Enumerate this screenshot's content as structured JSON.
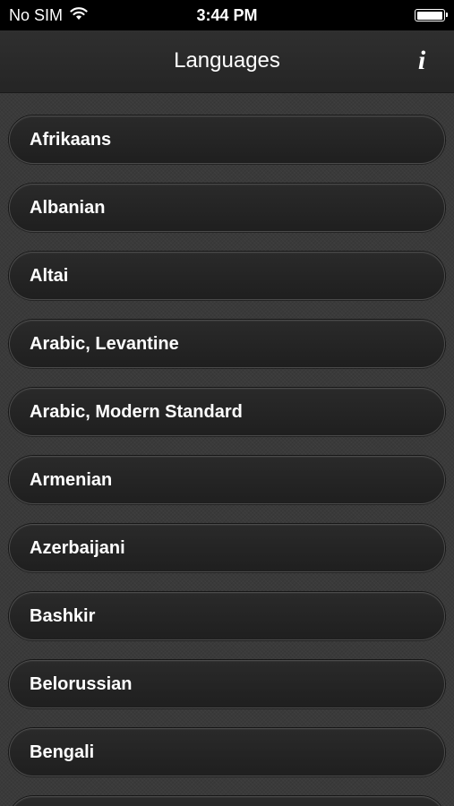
{
  "status_bar": {
    "carrier": "No SIM",
    "time": "3:44 PM",
    "battery_level": 1.0
  },
  "nav": {
    "title": "Languages",
    "info_glyph": "i"
  },
  "languages": [
    "Afrikaans",
    "Albanian",
    "Altai",
    "Arabic, Levantine",
    "Arabic, Modern Standard",
    "Armenian",
    "Azerbaijani",
    "Bashkir",
    "Belorussian",
    "Bengali",
    ""
  ]
}
